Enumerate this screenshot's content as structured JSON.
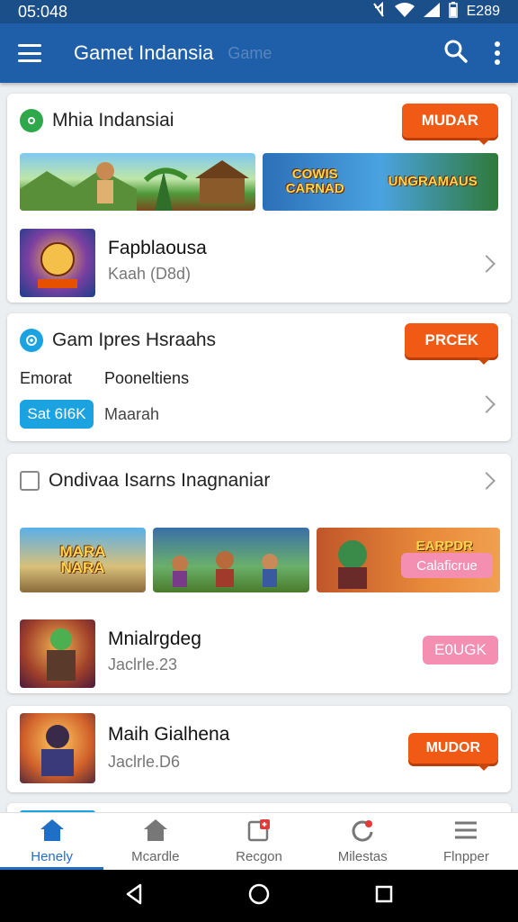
{
  "status_bar": {
    "time": "05:048",
    "battery": "E289"
  },
  "app_bar": {
    "title": "Gamet Indansia",
    "subtitle": "Game"
  },
  "card1": {
    "title": "Mhia Indansiai",
    "cta": "MUDAR",
    "banner_right_text": "COWIS CARNAD",
    "banner_right_text2": "UNGRAMAUS",
    "row_title": "Fapblaousa",
    "row_sub": "Kaah (D8d)"
  },
  "card2": {
    "title": "Gam Ipres Hsraahs",
    "cta": "PRCEK",
    "label_left": "Emorat",
    "label_right": "Pooneltiens",
    "pill": "Sat 6I6K",
    "pill_sub": "Maarah"
  },
  "card3": {
    "title": "Ondivaa Isarns Inagnaniar",
    "banner1_text": "MARA NARA",
    "banner3_text": "EARPDR",
    "banner3_pill": "Calaficrue",
    "row_title": "Mnialrgdeg",
    "row_sub": "Jaclrle.23",
    "row_pill": "E0UGK"
  },
  "card4": {
    "row_title": "Maih Gialhena",
    "row_sub": "Jaclrle.D6",
    "cta": "MUDOR"
  },
  "bottom_nav": [
    {
      "label": "Henely",
      "icon": "home-icon"
    },
    {
      "label": "Mcardle",
      "icon": "house-icon"
    },
    {
      "label": "Recgon",
      "icon": "gift-icon"
    },
    {
      "label": "Milestas",
      "icon": "refresh-icon"
    },
    {
      "label": "Flnpper",
      "icon": "menu-icon"
    }
  ],
  "colors": {
    "app_bar": "#1f5ea8",
    "accent": "#f15a14",
    "active_nav": "#1f6fc7",
    "pill_blue": "#1aa3e0",
    "pill_pink": "#f48fb1"
  }
}
